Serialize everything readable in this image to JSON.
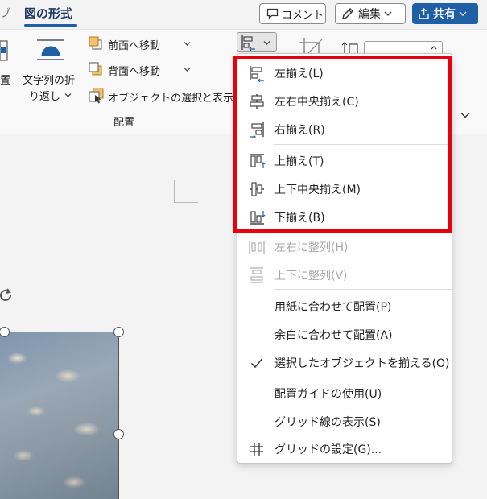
{
  "tabs": {
    "edge_fragment": "ブ",
    "active": "図の形式"
  },
  "header_buttons": {
    "comment": "コメント",
    "edit": "編集",
    "share": "共有"
  },
  "ribbon": {
    "position_fragment": "置",
    "wrap_text_line1": "文字列の折",
    "wrap_text_line2": "り返し",
    "bring_forward": "前面へ移動",
    "send_backward": "背面へ移動",
    "selection_pane": "オブジェクトの選択と表示",
    "arrange_group": "配置"
  },
  "menu": {
    "items": [
      {
        "label": "左揃え(L)",
        "icon": "align-left-icon",
        "enabled": true
      },
      {
        "label": "左右中央揃え(C)",
        "icon": "align-center-icon",
        "enabled": true
      },
      {
        "label": "右揃え(R)",
        "icon": "align-right-icon",
        "enabled": true
      },
      {
        "label": "上揃え(T)",
        "icon": "align-top-icon",
        "enabled": true
      },
      {
        "label": "上下中央揃え(M)",
        "icon": "align-middle-icon",
        "enabled": true
      },
      {
        "label": "下揃え(B)",
        "icon": "align-bottom-icon",
        "enabled": true
      },
      {
        "label": "左右に整列(H)",
        "icon": "distribute-horizontal-icon",
        "enabled": false
      },
      {
        "label": "上下に整列(V)",
        "icon": "distribute-vertical-icon",
        "enabled": false
      },
      {
        "label": "用紙に合わせて配置(P)",
        "icon": "",
        "enabled": true
      },
      {
        "label": "余白に合わせて配置(A)",
        "icon": "",
        "enabled": true
      },
      {
        "label": "選択したオブジェクトを揃える(O)",
        "icon": "check-icon",
        "enabled": true,
        "checked": true
      },
      {
        "label": "配置ガイドの使用(U)",
        "icon": "",
        "enabled": true
      },
      {
        "label": "グリッド線の表示(S)",
        "icon": "",
        "enabled": true
      },
      {
        "label": "グリッドの設定(G)...",
        "icon": "grid-icon",
        "enabled": true
      }
    ]
  },
  "colors": {
    "accent": "#1f5fa6",
    "highlight_box": "#e8000d",
    "disabled_text": "#a8a8a8"
  }
}
